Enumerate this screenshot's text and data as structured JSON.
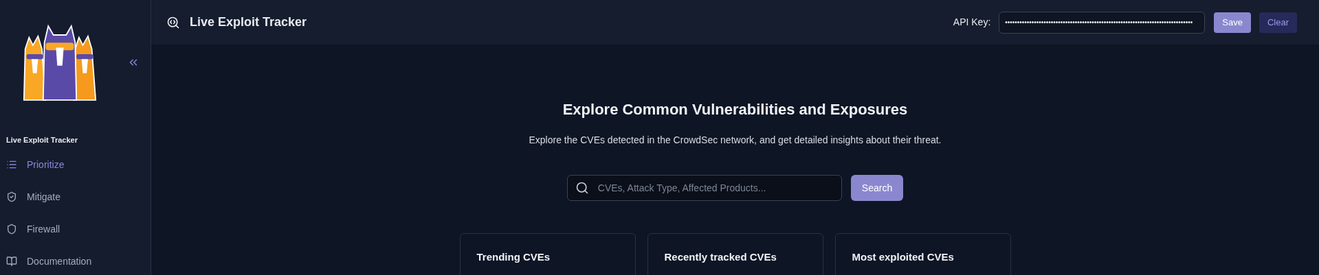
{
  "sidebar": {
    "section_title": "Live Exploit Tracker",
    "items": [
      {
        "label": "Prioritize",
        "selected": true
      },
      {
        "label": "Mitigate",
        "selected": false
      },
      {
        "label": "Firewall",
        "selected": false
      },
      {
        "label": "Documentation",
        "selected": false
      }
    ]
  },
  "header": {
    "title": "Live Exploit Tracker",
    "api_key_label": "API Key:",
    "api_key_value": "••••••••••••••••••••••••••••••••••••••••••••••••••••••••••••••••••••••••••••••",
    "buttons": [
      "Save",
      "Clear"
    ]
  },
  "main": {
    "heading": "Explore Common Vulnerabilities and Exposures",
    "subtitle": "Explore the CVEs detected in the CrowdSec network, and get detailed insights about their threat.",
    "search": {
      "placeholder": "CVEs, Attack Type, Affected Products...",
      "button": "Search"
    },
    "cards": [
      {
        "title": "Trending CVEs"
      },
      {
        "title": "Recently tracked CVEs"
      },
      {
        "title": "Most exploited CVEs"
      }
    ]
  }
}
